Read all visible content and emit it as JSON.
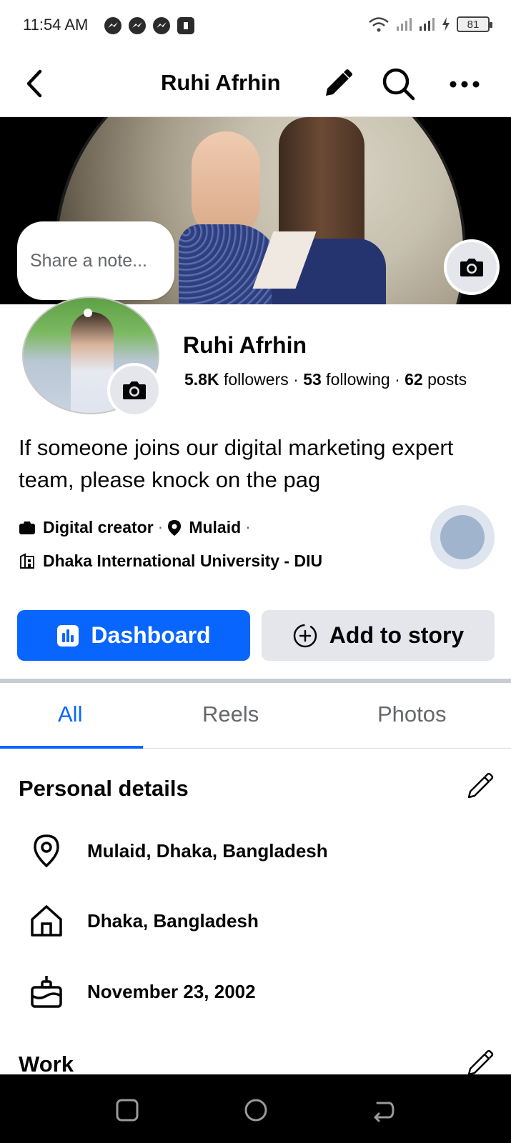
{
  "status_bar": {
    "time": "11:54 AM",
    "battery": "81",
    "left_icons": [
      "messenger-icon",
      "messenger-icon",
      "messenger-icon",
      "app-badge-icon"
    ],
    "right_icons": [
      "wifi-icon",
      "signal-icon",
      "signal-icon",
      "charging-icon",
      "battery-icon"
    ]
  },
  "header": {
    "title": "Ruhi Afrhin",
    "buttons": [
      "back-icon",
      "edit-pencil-icon",
      "search-icon",
      "more-icon"
    ]
  },
  "note": {
    "placeholder": "Share a note..."
  },
  "profile": {
    "name": "Ruhi Afrhin",
    "followers_count": "5.8K",
    "followers_label": " followers",
    "following_count": "53",
    "following_label": " following",
    "posts_count": "62",
    "posts_label": " posts",
    "stats_sep": " · ",
    "bio": "If someone joins our digital marketing expert team, please knock on the pag",
    "details": {
      "category": "Digital creator",
      "location": "Mulaid",
      "education": "Dhaka International University - DIU",
      "sep": "·"
    }
  },
  "actions": {
    "dashboard_label": "Dashboard",
    "add_story_label": "Add to story"
  },
  "tabs": [
    "All",
    "Reels",
    "Photos"
  ],
  "active_tab": "All",
  "personal_details": {
    "title": "Personal details",
    "rows": [
      {
        "icon": "location-pin-icon",
        "text": "Mulaid, Dhaka, Bangladesh"
      },
      {
        "icon": "home-icon",
        "text": "Dhaka, Bangladesh"
      },
      {
        "icon": "birthday-cake-icon",
        "text": "November 23, 2002"
      }
    ]
  },
  "work": {
    "title": "Work"
  },
  "colors": {
    "accent": "#0866ff",
    "secondary_button": "#e4e6eb",
    "muted_text": "#65676b",
    "text": "#050505"
  }
}
